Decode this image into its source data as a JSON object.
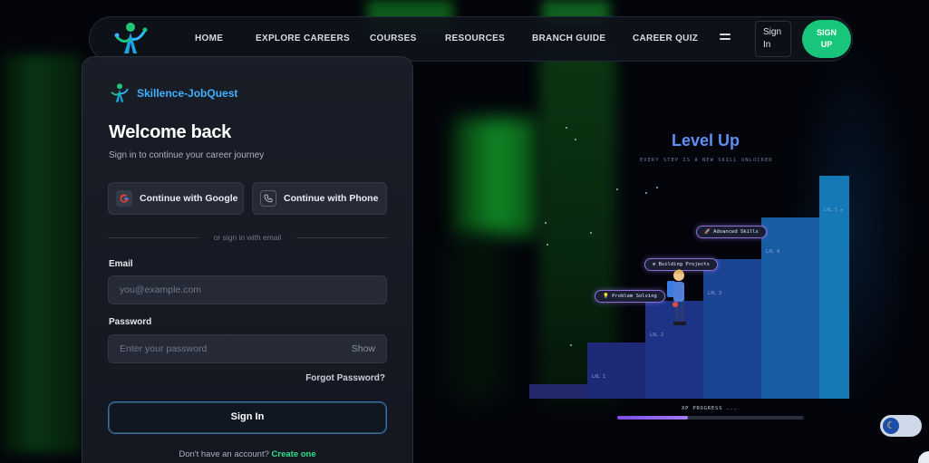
{
  "nav": {
    "links": [
      "HOME",
      "EXPLORE CAREERS",
      "COURSES",
      "RESOURCES",
      "BRANCH GUIDE",
      "CAREER QUIZ"
    ],
    "signin_label": "Sign\nIn",
    "signin_line1": "Sign",
    "signin_line2": "In",
    "signup_line1": "SIGN",
    "signup_line2": "UP"
  },
  "card": {
    "brand": "Skillence-JobQuest",
    "title": "Welcome back",
    "subtitle": "Sign in to continue your career journey",
    "google_label": "Continue with Google",
    "phone_label": "Continue with Phone",
    "divider": "or sign in with email",
    "email_label": "Email",
    "email_placeholder": "you@example.com",
    "password_label": "Password",
    "password_placeholder": "Enter your password",
    "show_label": "Show",
    "forgot_label": "Forgot Password?",
    "signin_label": "Sign In",
    "no_account": "Don't have an account?",
    "create_label": "Create one"
  },
  "art": {
    "title": "Level Up",
    "subtitle": "EVERY STEP IS A NEW SKILL UNLOCKED",
    "levels": [
      "LVL 1",
      "LVL 2",
      "LVL 3",
      "LVL 4",
      "LVL 5 ★"
    ],
    "badges": [
      "💡 Problem Solving",
      "⚙ Building Projects",
      "🚀 Advanced Skills"
    ],
    "xp_label": "XP PROGRESS ...",
    "xp_progress": 0.38
  },
  "colors": {
    "accent_green": "#17c67a",
    "brand_blue": "#3fb0ff",
    "level_title": "#5d8ef4"
  },
  "icons": {
    "logo": "skillence-logo",
    "menu": "menu-icon",
    "google": "google-icon",
    "phone": "phone-icon",
    "theme": "moon-icon"
  }
}
